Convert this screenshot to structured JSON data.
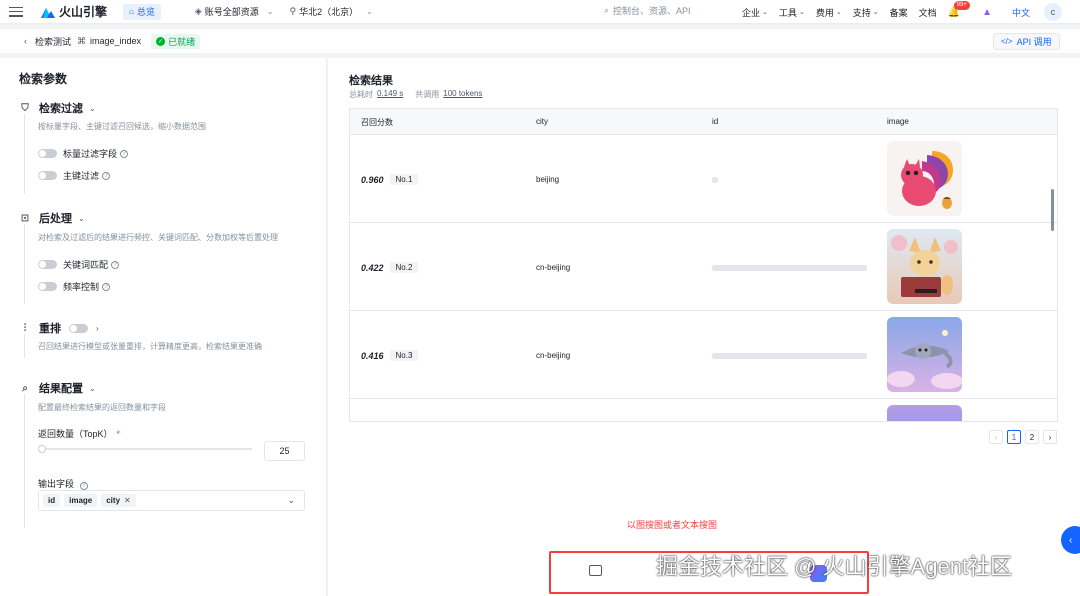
{
  "topnav": {
    "brand": "火山引擎",
    "home_label": "总览",
    "account_select": "账号全部资源",
    "region_select": "华北2（北京）",
    "search_placeholder": "控制台、资源、API",
    "menu": [
      {
        "label": "企业",
        "has_chevron": true
      },
      {
        "label": "工具",
        "has_chevron": true
      },
      {
        "label": "费用",
        "has_chevron": true
      },
      {
        "label": "支持",
        "has_chevron": true
      },
      {
        "label": "备案",
        "has_chevron": false
      },
      {
        "label": "文档",
        "has_chevron": false
      }
    ],
    "notification_badge": "99+",
    "language": "中文",
    "avatar_letter": "c"
  },
  "subbar": {
    "back_label": "检索测试",
    "index_name": "image_index",
    "status": "已就绪",
    "api_button": "API 调用"
  },
  "left": {
    "title": "检索参数",
    "filter": {
      "title": "检索过滤",
      "desc": "按标量字段、主键过滤召回候选，缩小数据范围",
      "toggles": [
        "标量过滤字段",
        "主键过滤"
      ]
    },
    "post": {
      "title": "后处理",
      "desc": "对检索及过滤后的结果进行频控、关键词匹配、分数加权等后置处理",
      "toggles": [
        "关键词匹配",
        "频率控制"
      ]
    },
    "rerank": {
      "title": "重排",
      "desc": "召回结果进行模型或张量重排，计算精度更高，检索结果更准确"
    },
    "result_config": {
      "title": "结果配置",
      "desc": "配置最终检索结果的返回数量和字段",
      "topk_label": "返回数量（TopK）",
      "topk_value": "25",
      "topk_slider_fraction": 0.0,
      "output_label": "输出字段",
      "output_fields": [
        "id",
        "image",
        "city"
      ]
    }
  },
  "right": {
    "title": "检索结果",
    "time_label": "总耗时",
    "time_value": "0.149 s",
    "tokens_label": "共调用",
    "tokens_value": "100 tokens",
    "columns": [
      "召回分数",
      "city",
      "id",
      "image"
    ],
    "rows": [
      {
        "score": "0.960",
        "rank": "No.1",
        "city": "beijing",
        "image": "squirrel-image"
      },
      {
        "score": "0.422",
        "rank": "No.2",
        "city": "cn-beijing",
        "image": "fox-image"
      },
      {
        "score": "0.416",
        "rank": "No.3",
        "city": "cn-beijing",
        "image": "flying-squirrel-image"
      }
    ],
    "pages": [
      "1",
      "2"
    ],
    "current_page": "1",
    "hint": "以图搜图或者文本搜图"
  },
  "watermark": "掘金技术社区 @ 火山引擎Agent社区",
  "colors": {
    "primary": "#1664ff",
    "success": "#00b42a",
    "danger": "#f53f3f"
  }
}
